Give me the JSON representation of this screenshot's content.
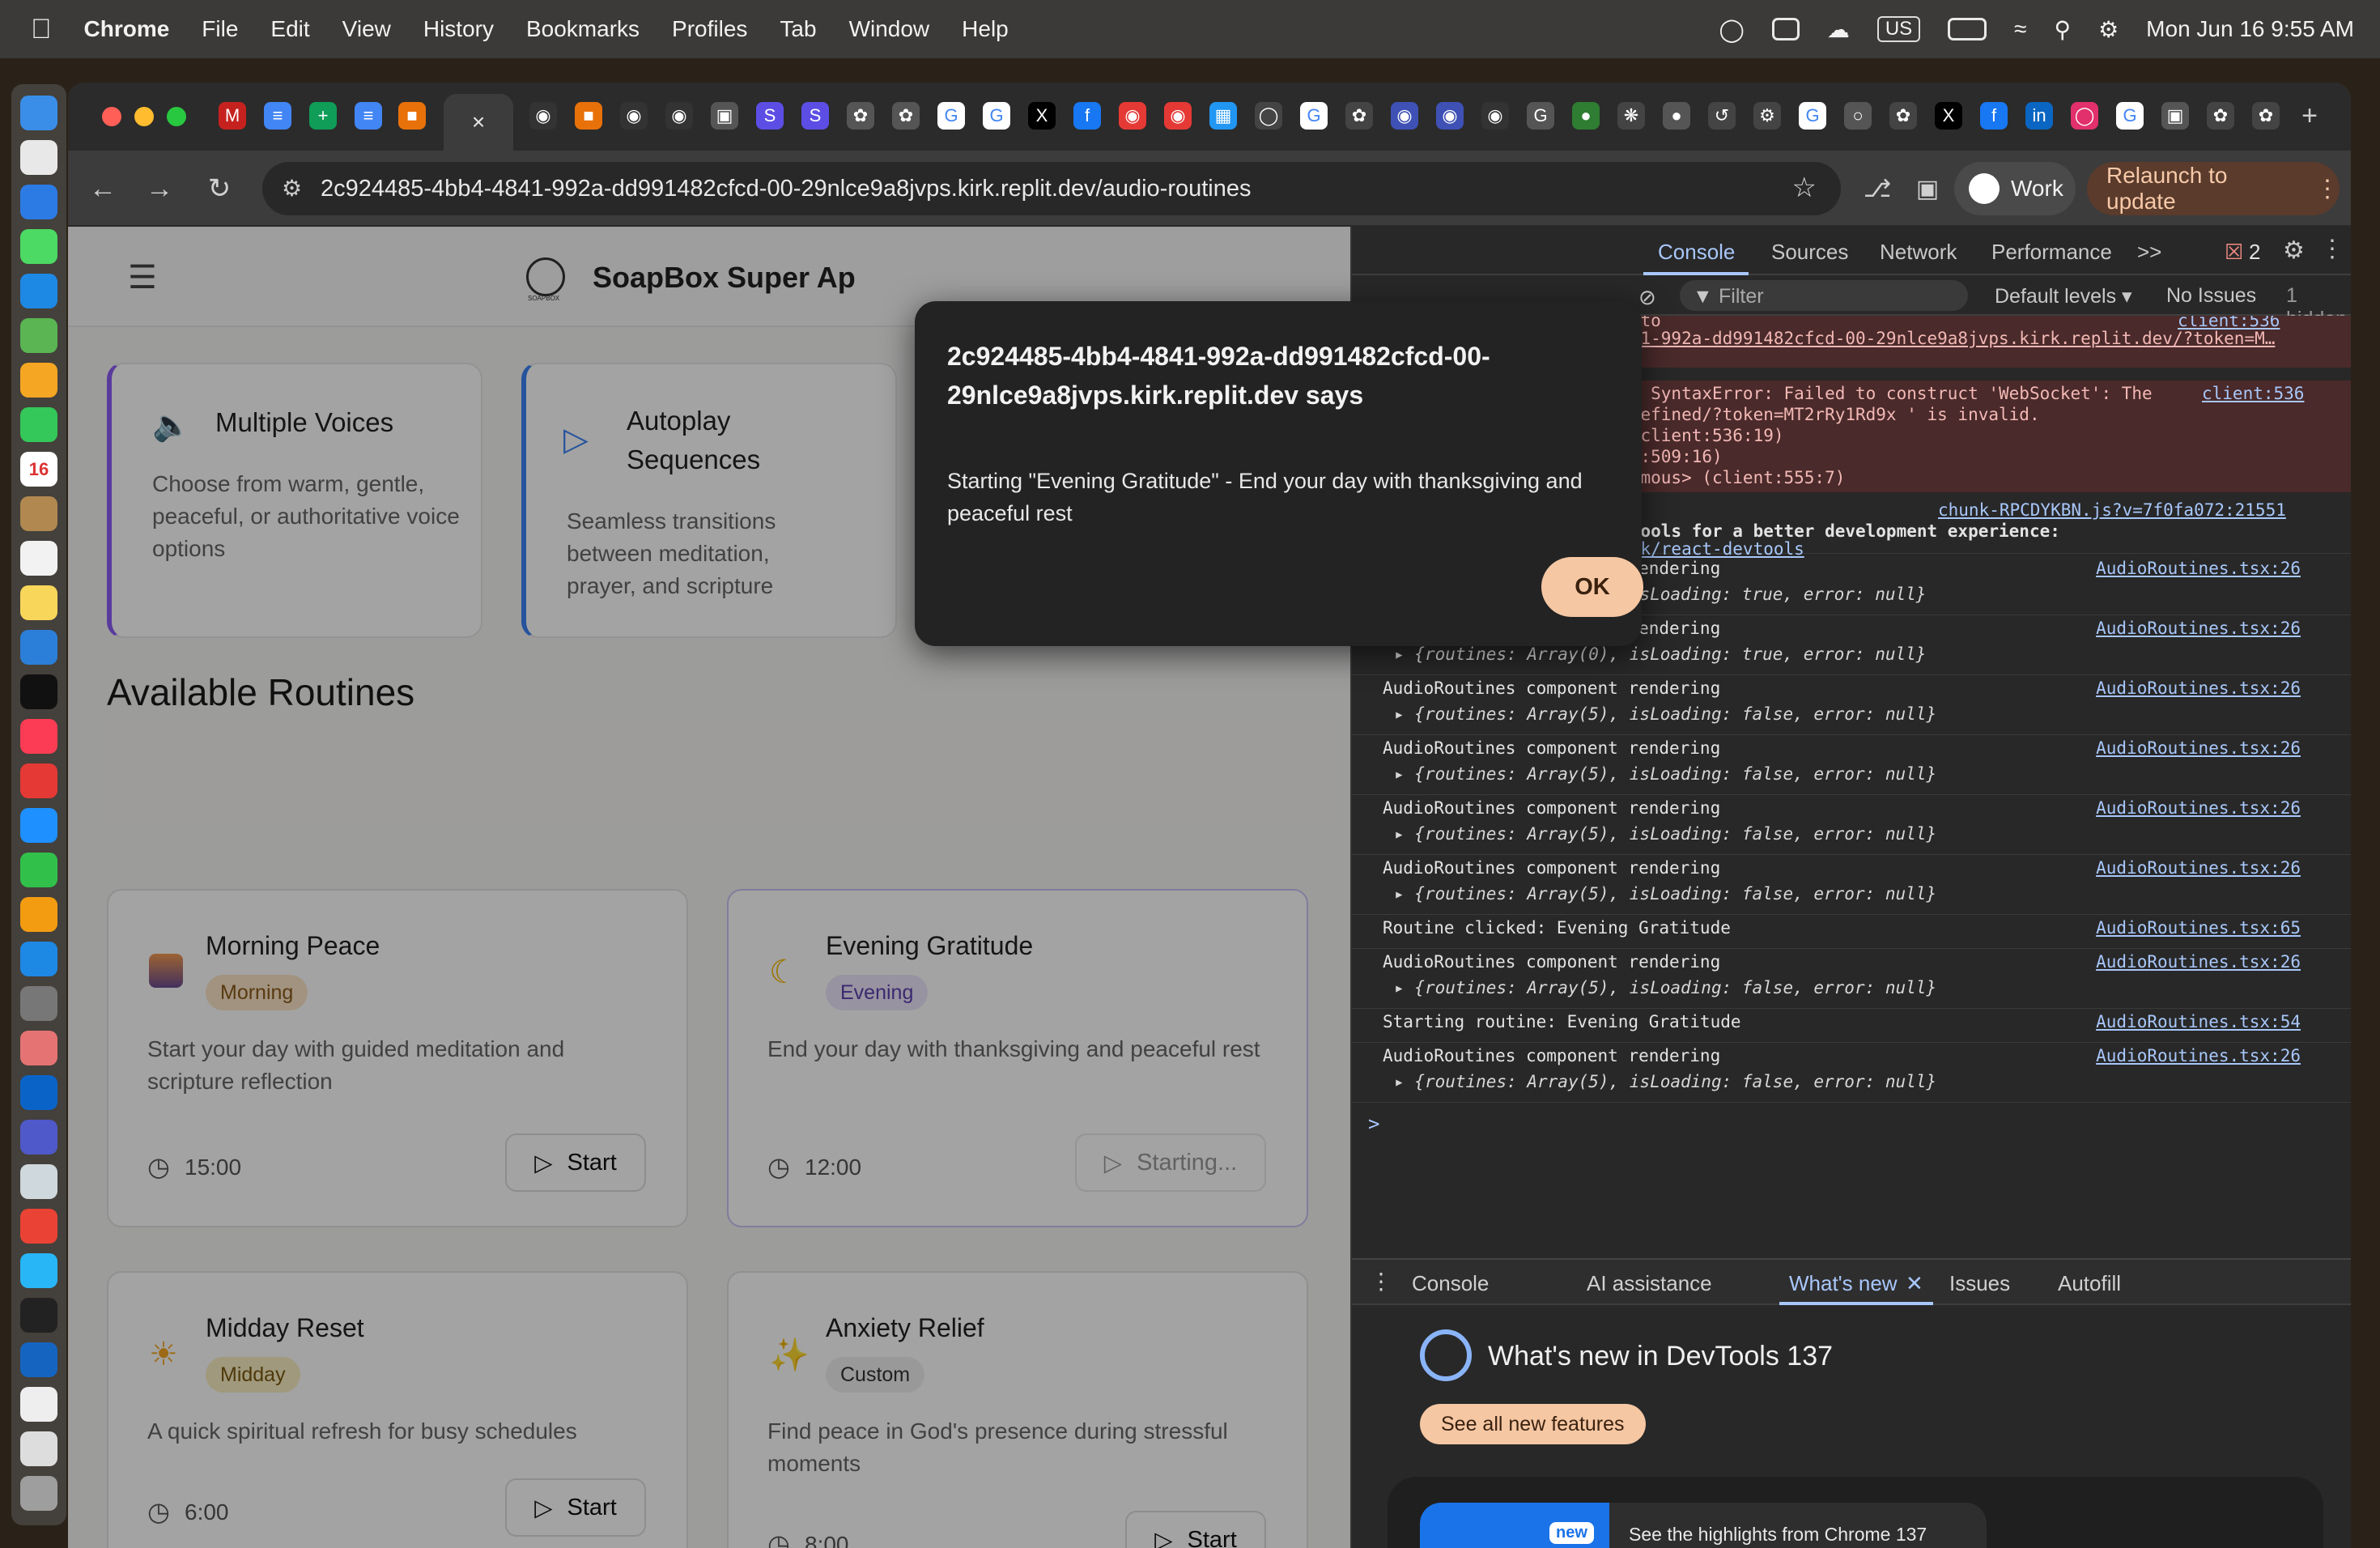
{
  "menubar": {
    "app": "Chrome",
    "items": [
      "File",
      "Edit",
      "View",
      "History",
      "Bookmarks",
      "Profiles",
      "Tab",
      "Window",
      "Help"
    ],
    "input_source": "US",
    "clock": "Mon Jun 16  9:55 AM"
  },
  "dock": {
    "calendar_day": "16"
  },
  "browser": {
    "url": "2c924485-4bb4-4841-992a-dd991482cfcd-00-29nlce9a8jvps.kirk.replit.dev/audio-routines",
    "profile": "Work",
    "relaunch": "Relaunch to update",
    "close_tab_glyph": "×",
    "new_tab_glyph": "+"
  },
  "app": {
    "name": "SoapBox Super Ap",
    "logo_caption": "SOAPBOX",
    "features": [
      {
        "title": "Multiple Voices",
        "desc": "Choose from warm, gentle, peaceful, or authoritative voice options",
        "icon": "speaker-icon"
      },
      {
        "title": "Autoplay Sequences",
        "desc": "Seamless transitions between meditation, prayer, and scripture",
        "icon": "play-icon"
      }
    ],
    "section_title": "Available Routines",
    "routines": [
      {
        "title": "Morning Peace",
        "badge": "Morning",
        "desc": "Start your day with guided meditation and scripture reflection",
        "duration": "15:00",
        "button": "Start"
      },
      {
        "title": "Evening Gratitude",
        "badge": "Evening",
        "desc": "End your day with thanksgiving and peaceful rest",
        "duration": "12:00",
        "button": "Starting..."
      },
      {
        "title": "Midday Reset",
        "badge": "Midday",
        "desc": "A quick spiritual refresh for busy schedules",
        "duration": "6:00",
        "button": "Start"
      },
      {
        "title": "Anxiety Relief",
        "badge": "Custom",
        "desc": "Find peace in God's presence during stressful moments",
        "duration": "8:00",
        "button": "Start"
      }
    ]
  },
  "dialog": {
    "host": "2c924485-4bb4-4841-992a-dd991482cfcd-00-29nlce9a8jvps.kirk.replit.dev says",
    "message": "Starting \"Evening Gratitude\" - End your day with thanksgiving and peaceful rest",
    "ok": "OK"
  },
  "devtools": {
    "tabs": [
      "Console",
      "Sources",
      "Network",
      "Performance"
    ],
    "more_tabs_glyph": ">>",
    "error_count": "2",
    "filter_placeholder": "Filter",
    "levels": "Default levels ▾",
    "issues": "No Issues",
    "hidden": "1 hidden",
    "error_lines": [
      "ection to",
      "bb4-4841-992a-dd991482cfcd-00-29nlce9a8jvps.kirk.replit.dev/?token=M…",
      "romise) SyntaxError: Failed to construct 'WebSocket': The",
      "ost:undefined/?token=MT2rRy1Rd9x ' is invalid.",
      "ocket (client:536:19)",
      "(client:509:16)",
      ".<anonymous> (client:555:7)"
    ],
    "error_src_top": "client:536",
    "error_src": "client:536",
    "info_src": "chunk-RPCDYKBN.js?v=7f0fa072:21551",
    "info_lines": [
      "ct DevTools for a better development experience:",
      "org/link/react-devtools"
    ],
    "logs": [
      {
        "text": "AudioRoutines component rendering",
        "detail": "{routines: Array(0), isLoading: true, error: null}",
        "src": "AudioRoutines.tsx:26"
      },
      {
        "text": "AudioRoutines component rendering",
        "detail": "{routines: Array(0), isLoading: true, error: null}",
        "src": "AudioRoutines.tsx:26"
      },
      {
        "text": "AudioRoutines component rendering",
        "detail": "{routines: Array(5), isLoading: false, error: null}",
        "src": "AudioRoutines.tsx:26"
      },
      {
        "text": "AudioRoutines component rendering",
        "detail": "{routines: Array(5), isLoading: false, error: null}",
        "src": "AudioRoutines.tsx:26"
      },
      {
        "text": "AudioRoutines component rendering",
        "detail": "{routines: Array(5), isLoading: false, error: null}",
        "src": "AudioRoutines.tsx:26"
      },
      {
        "text": "AudioRoutines component rendering",
        "detail": "{routines: Array(5), isLoading: false, error: null}",
        "src": "AudioRoutines.tsx:26"
      },
      {
        "text": "Routine clicked: Evening Gratitude",
        "detail": "",
        "src": "AudioRoutines.tsx:65"
      },
      {
        "text": "AudioRoutines component rendering",
        "detail": "{routines: Array(5), isLoading: false, error: null}",
        "src": "AudioRoutines.tsx:26"
      },
      {
        "text": "Starting routine: Evening Gratitude",
        "detail": "",
        "src": "AudioRoutines.tsx:54"
      },
      {
        "text": "AudioRoutines component rendering",
        "detail": "{routines: Array(5), isLoading: false, error: null}",
        "src": "AudioRoutines.tsx:26"
      }
    ],
    "prompt_glyph": ">",
    "drawer_tabs": [
      "Console",
      "AI assistance",
      "What's new",
      "Issues",
      "Autofill"
    ],
    "whats_new_title": "What's new in DevTools 137",
    "see_all": "See all new features",
    "highlight_badge": "new",
    "highlight_text": "See the highlights from Chrome 137"
  },
  "colors": {
    "relaunch_bg": "#5a3b2c",
    "ok_button": "#f6c7a3",
    "link": "#a8c7fa",
    "error_bg": "#4a2a2a"
  }
}
